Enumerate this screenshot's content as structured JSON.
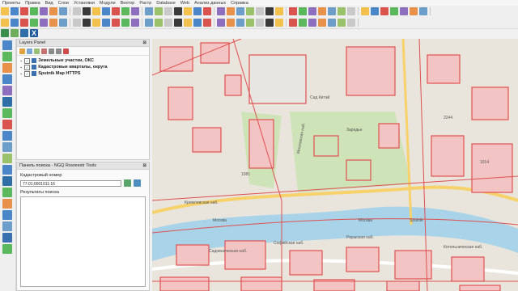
{
  "menu": [
    "Проекты",
    "Правка",
    "Вид",
    "Слои",
    "Установки",
    "Модули",
    "Вектор",
    "Растр",
    "Database",
    "Web",
    "Анализ данных",
    "Справка"
  ],
  "layers_panel": {
    "title": "Layers Panel",
    "layers": [
      {
        "label": "Земельные участки, ОКС",
        "checked": true
      },
      {
        "label": "Кадастровые кварталы, округа",
        "checked": true
      },
      {
        "label": "Sputnik Map HTTPS",
        "checked": true
      }
    ]
  },
  "search_panel": {
    "title": "Панель поиска - NGQ Rosreestr Tools",
    "field_label": "Кадастровый номер",
    "field_value": "77:01:0001011:16",
    "results_label": "Результаты поиска"
  },
  "map": {
    "labels": [
      "Московская наб.",
      "Москва",
      "Москва",
      "Раушская наб.",
      "Садовническая наб.",
      "Котельническая наб.",
      "Сад Китай",
      "Кремлевская наб.",
      "Зарядье",
      "1014",
      "1081",
      "2244",
      "Софийская наб.",
      "Sputnik"
    ]
  },
  "colors": {
    "parcel_stroke": "#e05050",
    "parcel_fill": "#f3c4c4",
    "river": "#a9d3e8",
    "park": "#cfe3b8",
    "road": "#f7d26b"
  }
}
